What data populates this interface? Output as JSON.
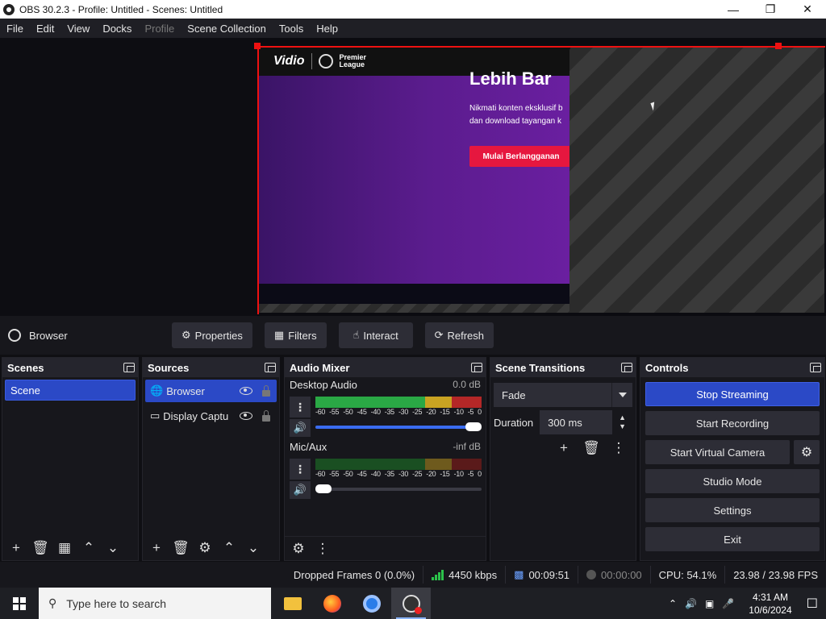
{
  "window": {
    "title": "OBS 30.2.3 - Profile: Untitled - Scenes: Untitled"
  },
  "menu": [
    "File",
    "Edit",
    "View",
    "Docks",
    "Profile",
    "Scene Collection",
    "Tools",
    "Help"
  ],
  "preview": {
    "site_logo": "Vidio",
    "site_partner": "Premier League",
    "heading": "Lebih Bar",
    "subtext_line1": "Nikmati konten eksklusif b",
    "subtext_line2": "dan download tayangan k",
    "cta": "Mulai Berlangganan"
  },
  "context_bar": {
    "source_name": "Browser",
    "properties": "Properties",
    "filters": "Filters",
    "interact": "Interact",
    "refresh": "Refresh"
  },
  "scenes": {
    "title": "Scenes",
    "items": [
      "Scene"
    ]
  },
  "sources": {
    "title": "Sources",
    "items": [
      "Browser",
      "Display Captu"
    ]
  },
  "mixer": {
    "title": "Audio Mixer",
    "channels": [
      {
        "name": "Desktop Audio",
        "db": "0.0 dB",
        "volume": 1.0
      },
      {
        "name": "Mic/Aux",
        "db": "-inf dB",
        "volume": 0.05
      }
    ],
    "scale": [
      "-60",
      "-55",
      "-50",
      "-45",
      "-40",
      "-35",
      "-30",
      "-25",
      "-20",
      "-15",
      "-10",
      "-5",
      "0"
    ]
  },
  "transitions": {
    "title": "Scene Transitions",
    "selected": "Fade",
    "duration_label": "Duration",
    "duration_value": "300 ms"
  },
  "controls": {
    "title": "Controls",
    "stop_streaming": "Stop Streaming",
    "start_recording": "Start Recording",
    "start_virtual_camera": "Start Virtual Camera",
    "studio_mode": "Studio Mode",
    "settings": "Settings",
    "exit": "Exit"
  },
  "status": {
    "dropped_frames": "Dropped Frames 0 (0.0%)",
    "bitrate": "4450 kbps",
    "stream_time": "00:09:51",
    "record_time": "00:00:00",
    "cpu": "CPU: 54.1%",
    "fps": "23.98 / 23.98 FPS"
  },
  "taskbar": {
    "search_placeholder": "Type here to search",
    "time": "4:31 AM",
    "date": "10/6/2024"
  },
  "colors": {
    "accent": "#2b49c6",
    "selection": "#ee1111",
    "meter_green": "#2aa845"
  }
}
